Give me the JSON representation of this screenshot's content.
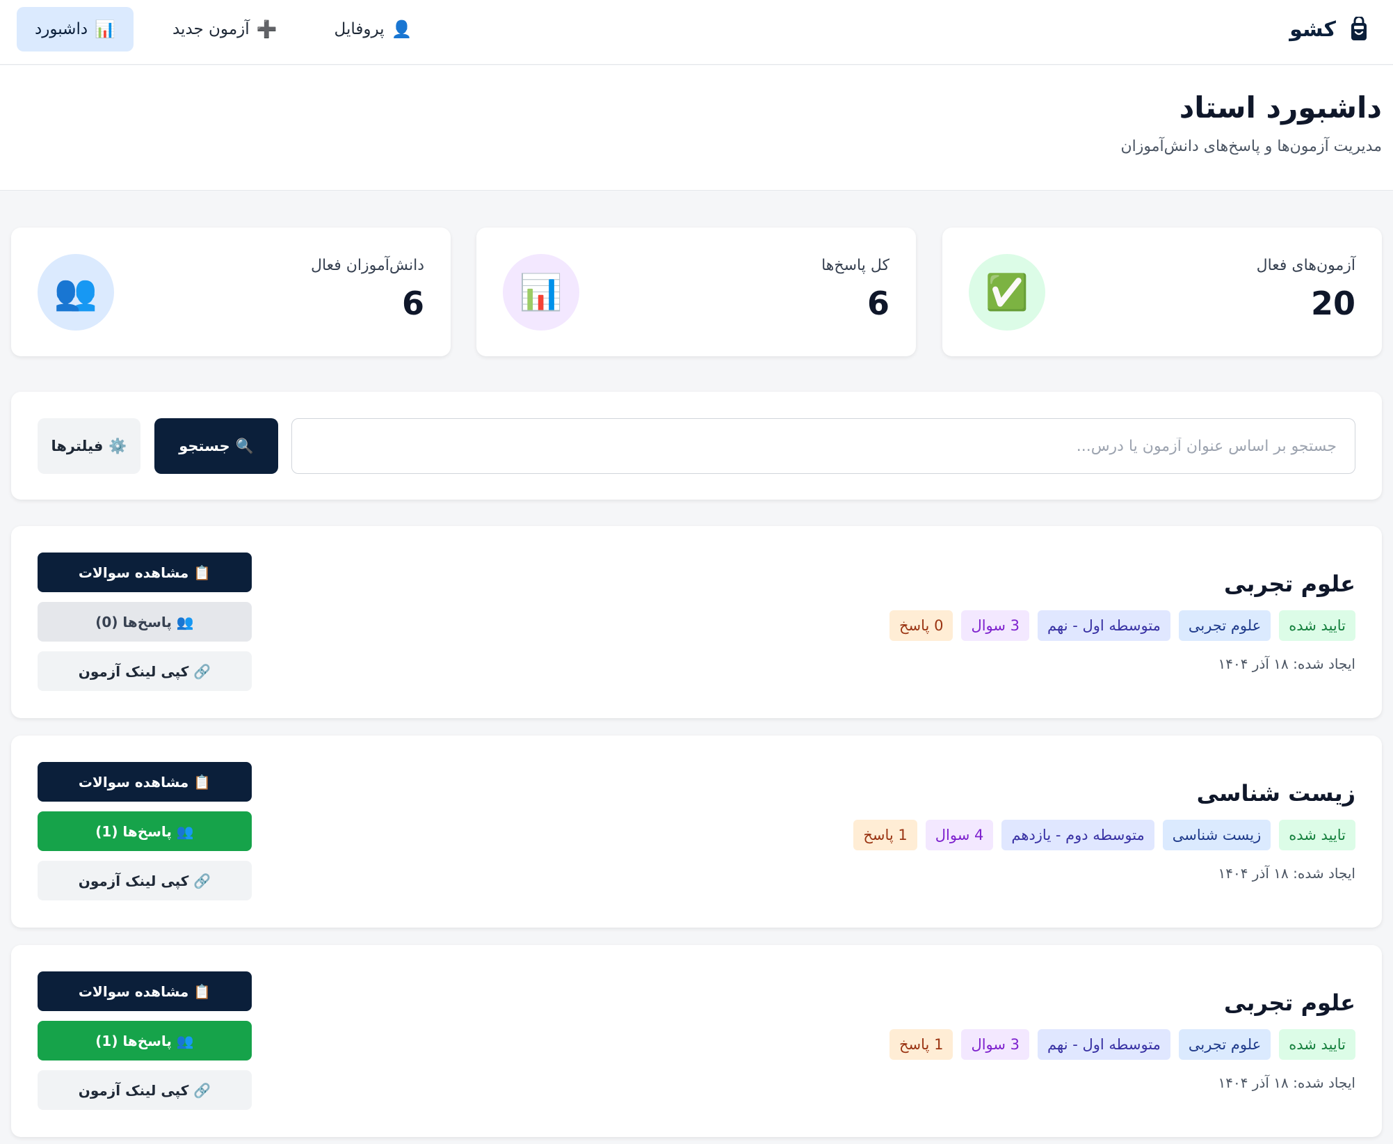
{
  "app": {
    "name": "کشو",
    "logo_icon": "bag-icon"
  },
  "nav": {
    "items": [
      {
        "label": "داشبورد",
        "emoji": "📊",
        "icon": "chart-icon",
        "active": true
      },
      {
        "label": "آزمون جدید",
        "emoji": "➕",
        "icon": "plus-icon",
        "active": false
      },
      {
        "label": "پروفایل",
        "emoji": "👤",
        "icon": "user-icon",
        "active": false
      }
    ]
  },
  "header": {
    "title": "داشبورد استاد",
    "subtitle": "مدیریت آزمون‌ها و پاسخ‌های دانش‌آموزان"
  },
  "stats": [
    {
      "label": "آزمون‌های فعال",
      "value": "20",
      "emoji": "✅",
      "icon": "check-icon",
      "icon_bg": "#dcfce7"
    },
    {
      "label": "کل پاسخ‌ها",
      "value": "6",
      "emoji": "📊",
      "icon": "chart-icon",
      "icon_bg": "#f3e8ff"
    },
    {
      "label": "دانش‌آموزان فعال",
      "value": "6",
      "emoji": "👥",
      "icon": "users-icon",
      "icon_bg": "#dbeafe"
    }
  ],
  "search": {
    "placeholder": "جستجو بر اساس عنوان آزمون یا درس...",
    "value": "",
    "search_label": "جستجو",
    "search_emoji": "🔍",
    "filter_label": "فیلترها",
    "filter_emoji": "⚙️"
  },
  "exams": [
    {
      "title": "علوم تجربی",
      "status": "تایید شده",
      "subject": "علوم تجربی",
      "grade": "متوسطه اول - نهم",
      "questions": "3 سوال",
      "answers": "0 پاسخ",
      "created": "ایجاد شده: ۱۸ آذر ۱۴۰۴",
      "view_label": "📋 مشاهده سوالات",
      "responses_label": "👥 پاسخ‌ها (0)",
      "responses_style": "gray",
      "copy_label": "🔗 کپی لینک آزمون"
    },
    {
      "title": "زیست شناسی",
      "status": "تایید شده",
      "subject": "زیست شناسی",
      "grade": "متوسطه دوم - یازدهم",
      "questions": "4 سوال",
      "answers": "1 پاسخ",
      "created": "ایجاد شده: ۱۸ آذر ۱۴۰۴",
      "view_label": "📋 مشاهده سوالات",
      "responses_label": "👥 پاسخ‌ها (1)",
      "responses_style": "green",
      "copy_label": "🔗 کپی لینک آزمون"
    },
    {
      "title": "علوم تجربی",
      "status": "تایید شده",
      "subject": "علوم تجربی",
      "grade": "متوسطه اول - نهم",
      "questions": "3 سوال",
      "answers": "1 پاسخ",
      "created": "ایجاد شده: ۱۸ آذر ۱۴۰۴",
      "view_label": "📋 مشاهده سوالات",
      "responses_label": "👥 پاسخ‌ها (1)",
      "responses_style": "green",
      "copy_label": "🔗 کپی لینک آزمون"
    }
  ],
  "colors": {
    "primary": "#0b1f3a",
    "success": "#16a34a",
    "background": "#f5f6f8"
  }
}
